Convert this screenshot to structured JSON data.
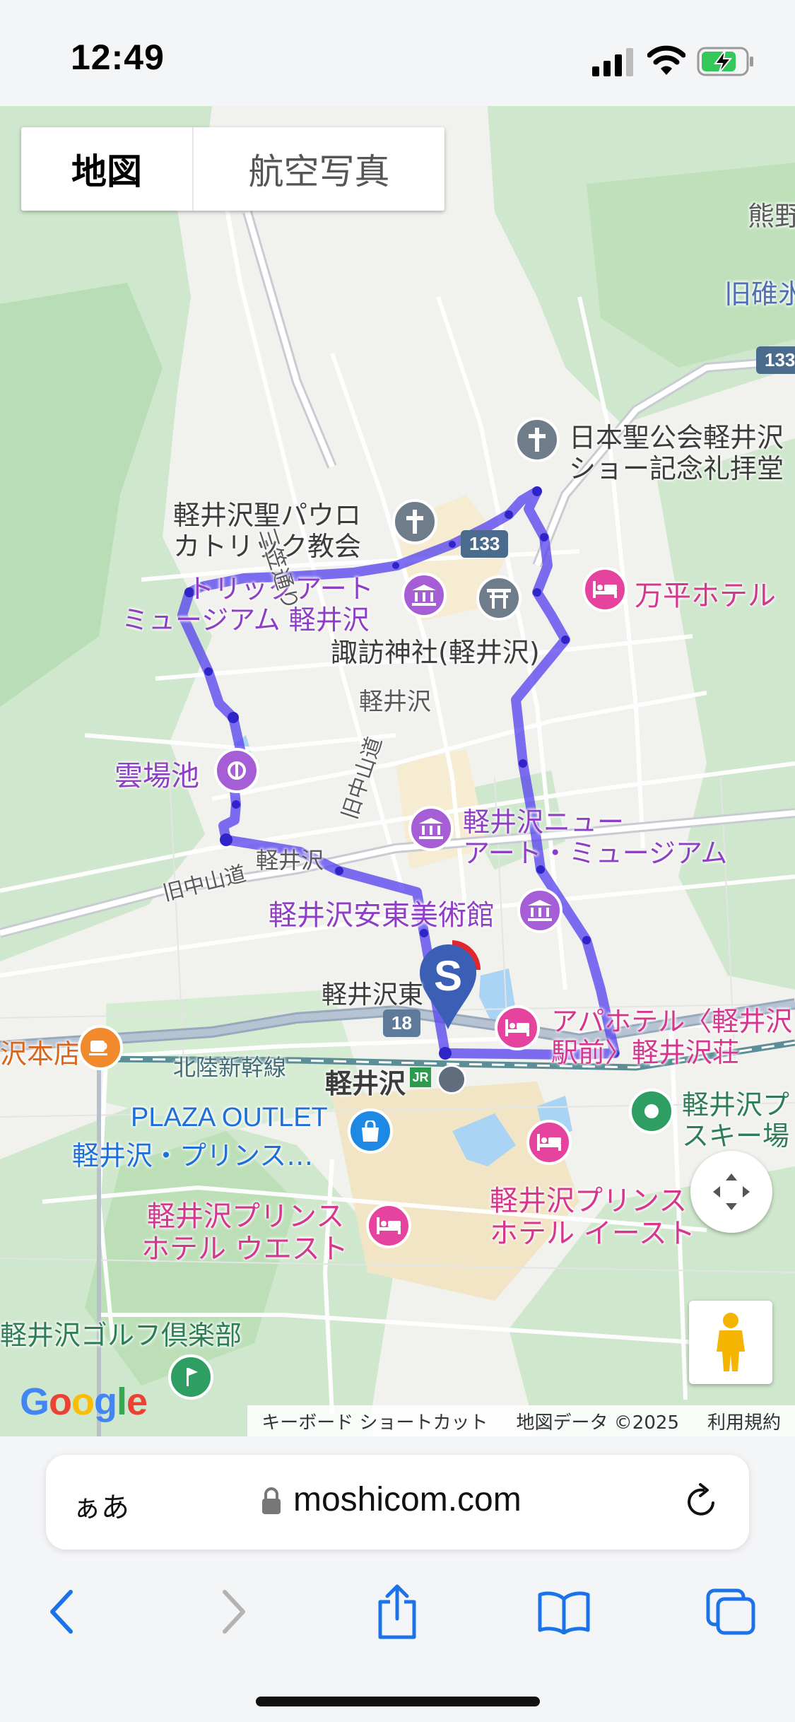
{
  "status_bar": {
    "time": "12:49"
  },
  "map_type": {
    "map_label": "地図",
    "satellite_label": "航空写真"
  },
  "route_color": "#5a46f0",
  "start_marker": {
    "letter": "S"
  },
  "shields": {
    "route133": "133",
    "route133_edge": "133",
    "route18": "18"
  },
  "labels": {
    "kumano": "熊野",
    "kyuusui": "旧碓氷",
    "church_anglican_1": "日本聖公会軽井沢",
    "church_anglican_2": "ショー記念礼拝堂",
    "church_paul_1": "軽井沢聖パウロ",
    "church_paul_2": "カトリック教会",
    "trickart_1": "トリックアート",
    "trickart_2": "ミュージアム 軽井沢",
    "manpei": "万平ホテル",
    "suwa": "諏訪神社(軽井沢)",
    "karuizawa_area": "軽井沢",
    "sanja": "三笠通り",
    "kyunakasendo_v": "旧中山道",
    "kumobaike": "雲場池",
    "new_art_1": "軽井沢ニュー",
    "new_art_2": "アート・ミュージアム",
    "karuizawa_road": "軽井沢",
    "kyunakasendo": "旧中山道",
    "ando": "軽井沢安東美術館",
    "higashi": "軽井沢東",
    "apa_1": "アパホテル〈軽井沢",
    "apa_2": "駅前〉軽井沢荘",
    "honten": "沢本店",
    "hokuriku": "北陸新幹線",
    "station": "軽井沢",
    "plaza_1": "PLAZA OUTLET",
    "plaza_2": "軽井沢・プリンス…",
    "ski_1": "軽井沢プ",
    "ski_2": "スキー場",
    "prince_east_1": "軽井沢プリンス",
    "prince_east_2": "ホテル イースト",
    "prince_west_1": "軽井沢プリンス",
    "prince_west_2": "ホテル ウエスト",
    "golf": "軽井沢ゴルフ倶楽部"
  },
  "footer": {
    "keyboard": "キーボード ショートカット",
    "mapdata": "地図データ ©2025",
    "terms": "利用規約"
  },
  "google_logo": "Google",
  "address_bar": {
    "aa": "ぁあ",
    "url": "moshicom.com"
  },
  "toolbar": {
    "back_icon": "chevron-left-icon",
    "forward_icon": "chevron-right-icon",
    "share_icon": "share-icon",
    "bookmarks_icon": "book-icon",
    "tabs_icon": "tabs-icon"
  }
}
